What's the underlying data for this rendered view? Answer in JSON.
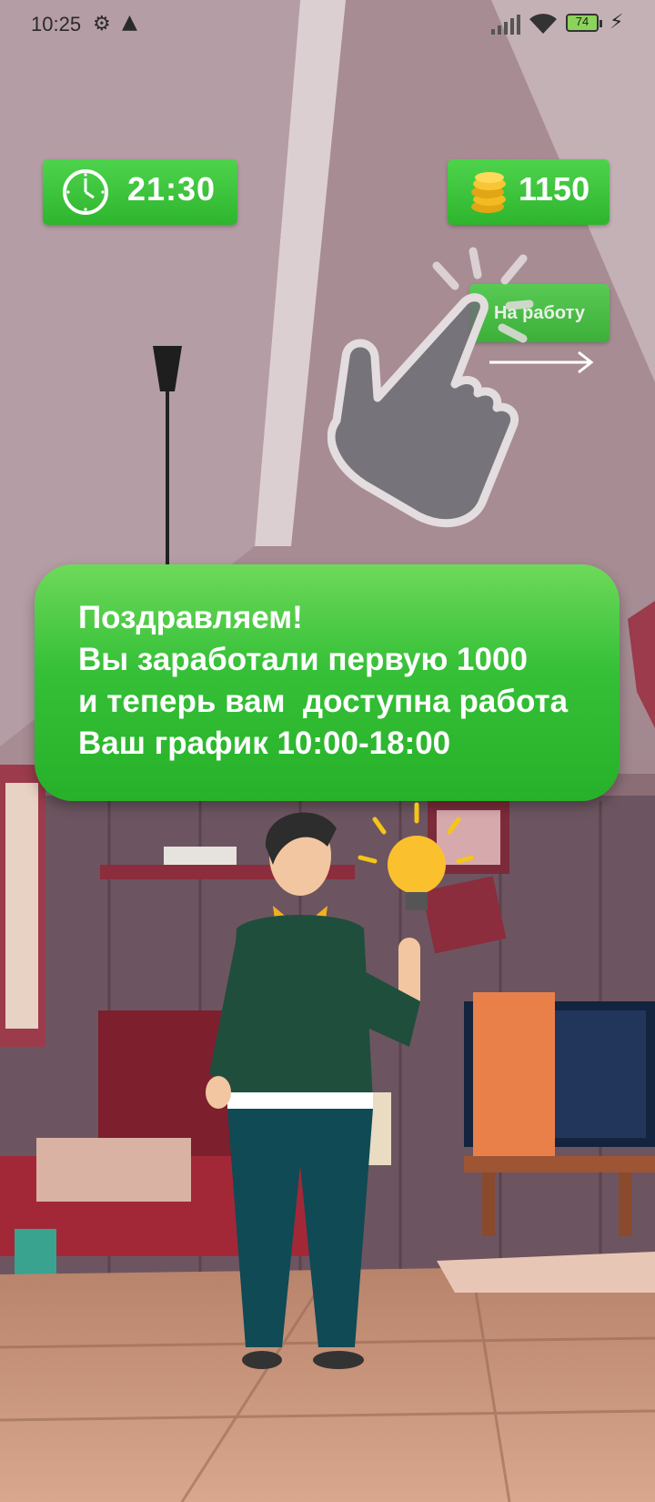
{
  "status_bar": {
    "time": "10:25",
    "battery": "74",
    "icons": [
      "settings-gear-icon",
      "warning-icon",
      "signal-icon",
      "wifi-icon",
      "battery-icon",
      "charging-icon"
    ]
  },
  "hud": {
    "time_label": "21:30",
    "coins_label": "1150",
    "work_button_label": "На работу"
  },
  "message": {
    "text": "Поздравляем!\nВы заработали первую 1000\nи теперь вам  доступна работа\nВаш график 10:00-18:00"
  },
  "colors": {
    "accent_green": "#3cc53a",
    "text_white": "#ffffff"
  }
}
